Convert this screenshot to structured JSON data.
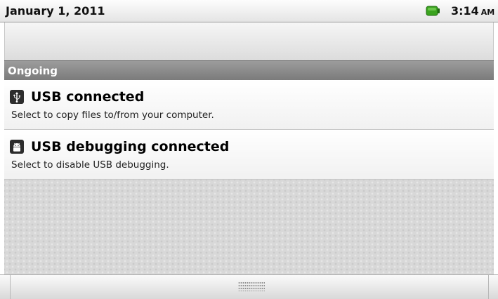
{
  "status_bar": {
    "date": "January 1, 2011",
    "time": "3:14",
    "ampm": "AM",
    "battery_icon": "battery-icon",
    "battery_color": "#3aa31e"
  },
  "section": {
    "title": "Ongoing"
  },
  "notifications": [
    {
      "icon": "usb-icon",
      "title": "USB connected",
      "text": "Select to copy files to/from your computer."
    },
    {
      "icon": "android-debug-icon",
      "title": "USB debugging connected",
      "text": "Select to disable USB debugging."
    }
  ],
  "bottom_bar": {
    "handle_icon": "drag-handle-icon"
  }
}
